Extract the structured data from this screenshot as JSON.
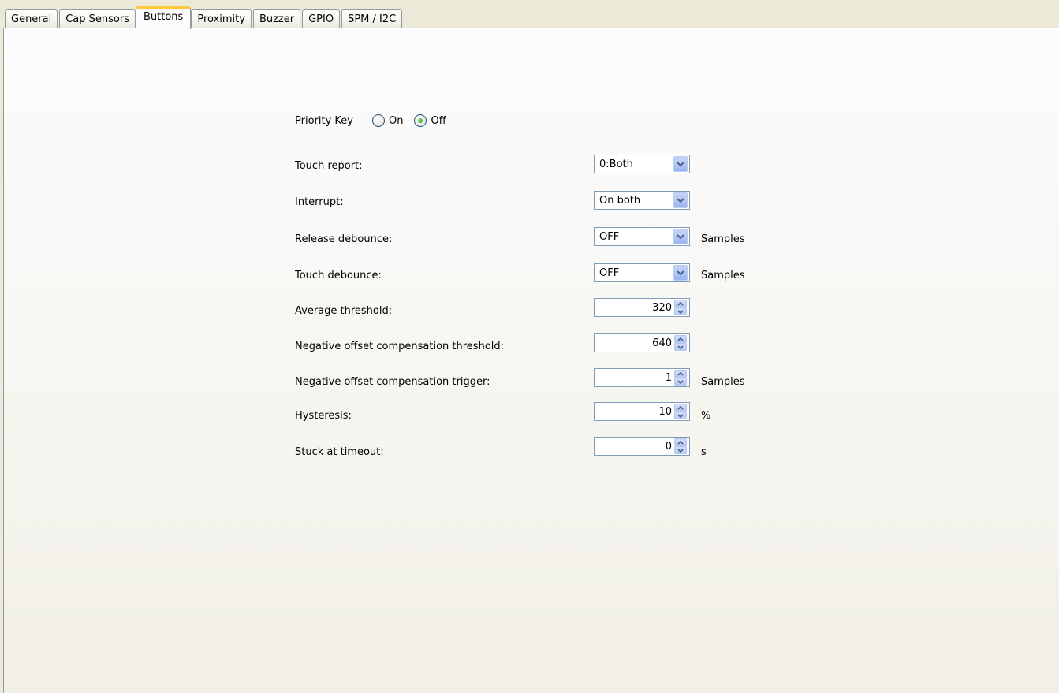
{
  "tabs": [
    {
      "label": "General",
      "active": false
    },
    {
      "label": "Cap Sensors",
      "active": false
    },
    {
      "label": "Buttons",
      "active": true
    },
    {
      "label": "Proximity",
      "active": false
    },
    {
      "label": "Buzzer",
      "active": false
    },
    {
      "label": "GPIO",
      "active": false
    },
    {
      "label": "SPM / I2C",
      "active": false
    }
  ],
  "priority_key": {
    "label": "Priority Key",
    "options": [
      {
        "label": "On",
        "selected": false
      },
      {
        "label": "Off",
        "selected": true
      }
    ]
  },
  "fields": {
    "touch_report": {
      "label": "Touch report:",
      "value": "0:Both",
      "unit": ""
    },
    "interrupt": {
      "label": "Interrupt:",
      "value": "On both",
      "unit": ""
    },
    "release_debounce": {
      "label": "Release debounce:",
      "value": "OFF",
      "unit": "Samples"
    },
    "touch_debounce": {
      "label": "Touch debounce:",
      "value": "OFF",
      "unit": "Samples"
    },
    "average_threshold": {
      "label": "Average threshold:",
      "value": "320",
      "unit": ""
    },
    "neg_offset_threshold": {
      "label": "Negative offset compensation threshold:",
      "value": "640",
      "unit": ""
    },
    "neg_offset_trigger": {
      "label": "Negative offset compensation trigger:",
      "value": "1",
      "unit": "Samples"
    },
    "hysteresis": {
      "label": "Hysteresis:",
      "value": "10",
      "unit": "%"
    },
    "stuck_timeout": {
      "label": "Stuck at timeout:",
      "value": "0",
      "unit": "s"
    }
  },
  "colors": {
    "background": "#ece9d8",
    "active_tab_accent": "#ffc83c",
    "border": "#7f9db9",
    "radio_selected": "#21a121"
  }
}
